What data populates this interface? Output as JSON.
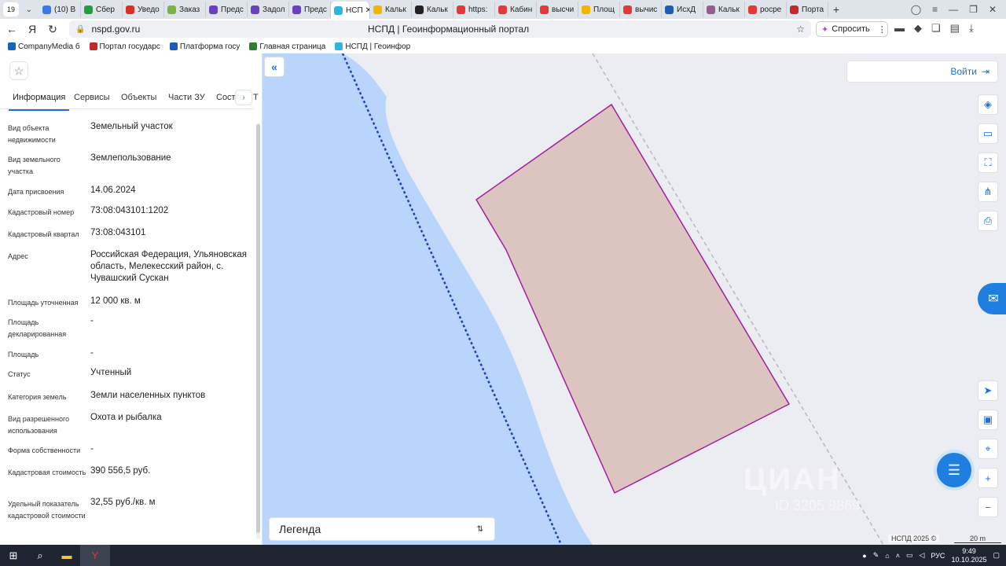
{
  "browser": {
    "tab_count": "19",
    "tabs": [
      {
        "label": "(10) В",
        "color": "#3b78e7"
      },
      {
        "label": "Сбер",
        "color": "#21a038"
      },
      {
        "label": "Уведо",
        "color": "#d93025"
      },
      {
        "label": "Заказ",
        "color": "#7cb342"
      },
      {
        "label": "Предс",
        "color": "#6a3fc1"
      },
      {
        "label": "Задол",
        "color": "#6a3fc1"
      },
      {
        "label": "Предс",
        "color": "#6a3fc1"
      },
      {
        "label": "НСП",
        "color": "#2fb5e0",
        "active": true
      },
      {
        "label": "Кальк",
        "color": "#f5b400"
      },
      {
        "label": "Кальк",
        "color": "#222222"
      },
      {
        "label": "https:",
        "color": "#e53935"
      },
      {
        "label": "Кабин",
        "color": "#e53935"
      },
      {
        "label": "высчи",
        "color": "#e53935"
      },
      {
        "label": "Площ",
        "color": "#f5b400"
      },
      {
        "label": "вычис",
        "color": "#e53935"
      },
      {
        "label": "ИсхД",
        "color": "#1e5bb8"
      },
      {
        "label": "Кальк",
        "color": "#9a5c8e"
      },
      {
        "label": "росре",
        "color": "#e53935"
      },
      {
        "label": "Порта",
        "color": "#c62828"
      }
    ],
    "url": "nspd.gov.ru",
    "page_title": "НСПД | Геоинформационный портал",
    "ask_label": "Спросить",
    "bookmarks": [
      {
        "label": "CompanyMedia б",
        "color": "#1565c0"
      },
      {
        "label": "Портал государс",
        "color": "#c62828"
      },
      {
        "label": "Платформа госу",
        "color": "#1e5bb8"
      },
      {
        "label": "Главная страница",
        "color": "#2e7d32"
      },
      {
        "label": "НСПД | Геоинфор",
        "color": "#2fb5e0"
      }
    ]
  },
  "panel": {
    "tabs": [
      "Информация",
      "Сервисы",
      "Объекты",
      "Части ЗУ",
      "Соста"
    ],
    "active_tab": "Информация",
    "tab_cut": "Т",
    "rows": [
      {
        "label": "Вид объекта недвижимости",
        "value": "Земельный участок"
      },
      {
        "label": "Вид земельного участка",
        "value": "Землепользование"
      },
      {
        "label": "Дата присвоения",
        "value": "14.06.2024"
      },
      {
        "label": "Кадастровый номер",
        "value": "73:08:043101:1202"
      },
      {
        "label": "Кадастровый квартал",
        "value": "73:08:043101"
      },
      {
        "label": "Адрес",
        "value": "Российская Федерация, Ульяновская область, Мелекесский район, с. Чувашский Сускан"
      },
      {
        "label": "Площадь уточненная",
        "value": "12 000 кв. м"
      },
      {
        "label": "Площадь декларированная",
        "value": "-"
      },
      {
        "label": "Площадь",
        "value": "-"
      },
      {
        "label": "Статус",
        "value": "Учтенный"
      },
      {
        "label": "Категория земель",
        "value": "Земли населенных пунктов"
      },
      {
        "label": "Вид разрешенного использования",
        "value": "Охота и рыбалка"
      },
      {
        "label": "Форма собственности",
        "value": "-"
      },
      {
        "label": "Кадастровая стоимость",
        "value": "390 556,5 руб."
      },
      {
        "label": "Удельный показатель кадастровой стоимости",
        "value": "32,55 руб./кв. м"
      }
    ]
  },
  "map": {
    "login_label": "Войти",
    "legend_label": "Легенда",
    "copyright": "НСПД 2025 ©",
    "scale_label": "20 m",
    "watermark": "ЦИАН",
    "watermark_id": "ID 3205 9869",
    "colors": {
      "water": "#b9d5fb",
      "parcel_fill": "#dcc5c0",
      "parcel_stroke": "#a020a0",
      "boundary": "#1a3fc8",
      "accent": "#1e6fd9"
    }
  },
  "taskbar": {
    "lang": "РУС",
    "time": "9:49",
    "date": "10.10.2025"
  }
}
